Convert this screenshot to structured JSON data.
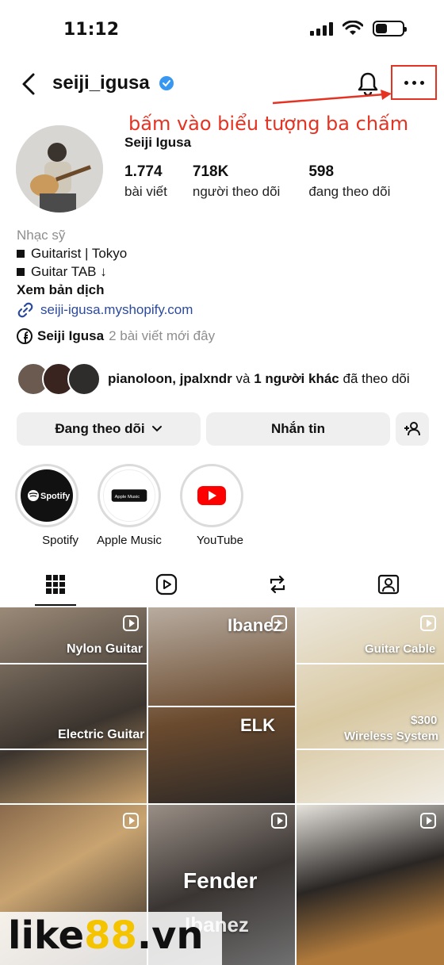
{
  "status_bar": {
    "time": "11:12"
  },
  "header": {
    "username": "seiji_igusa"
  },
  "annotation": {
    "text": "bấm vào biểu tượng ba chấm"
  },
  "profile": {
    "full_name": "Seiji Igusa",
    "stats": [
      {
        "value": "1.774",
        "label": "bài viết"
      },
      {
        "value": "718K",
        "label": "người theo dõi"
      },
      {
        "value": "598",
        "label": "đang theo dõi"
      }
    ],
    "category": "Nhạc sỹ",
    "bio_lines": [
      "Guitarist | Tokyo",
      "Guitar TAB ↓"
    ],
    "translate": "Xem bản dịch",
    "link": "seiji-igusa.myshopify.com",
    "facebook": {
      "name": "Seiji Igusa",
      "meta": "2 bài viết mới đây"
    },
    "mutual": {
      "names": "pianoloon, jpalxndr",
      "and": "và",
      "others": "1 người khác",
      "suffix": "đã theo dõi"
    }
  },
  "buttons": {
    "following": "Đang theo dõi",
    "message": "Nhắn tin"
  },
  "highlights": [
    {
      "label": "Spotify",
      "icon": "Spotify"
    },
    {
      "label": "Apple Music",
      "icon": "Apple Music"
    },
    {
      "label": "YouTube",
      "icon": "youtube-icon"
    }
  ],
  "grid": {
    "overlays": [
      "Nylon Guitar",
      "Ibanez",
      "Guitar Cable",
      "Electric Guitar",
      "ELK",
      "$300",
      "Wireless System",
      "Fender",
      "Ibanez"
    ]
  },
  "watermark": {
    "brand_a": "like",
    "brand_b": "88",
    "brand_c": ".vn"
  },
  "colors": {
    "annotation": "#e53323",
    "link": "#2c4a9c",
    "button_bg": "#efefef",
    "verified": "#3897f0",
    "watermark_accent": "#f5c400"
  }
}
